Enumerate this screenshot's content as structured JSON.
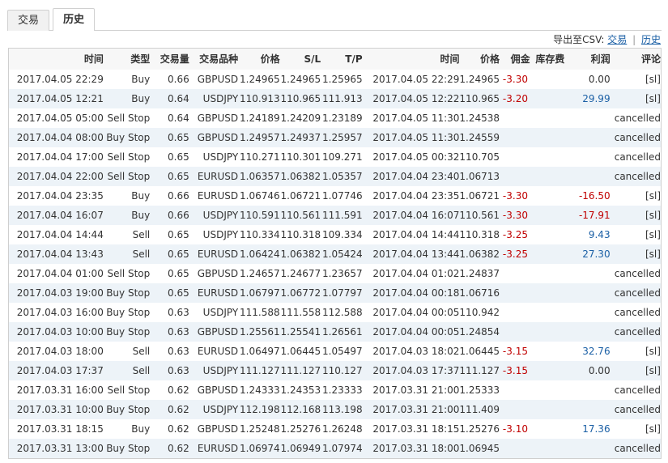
{
  "tabs": [
    {
      "label": "交易",
      "active": false
    },
    {
      "label": "历史",
      "active": true
    }
  ],
  "export": {
    "label": "导出至CSV:",
    "link1": "交易",
    "separator": "|",
    "link2": "历史"
  },
  "colors": {
    "negative": "#c00000",
    "positive": "#1a5fa5",
    "row_alt": "#edf3f8",
    "header_bg": "#f7f7f7"
  },
  "table": {
    "headers": [
      "时间",
      "类型",
      "交易量",
      "交易品种",
      "价格",
      "S/L",
      "T/P",
      "时间",
      "价格",
      "佣金",
      "库存费",
      "利润",
      "评论"
    ],
    "rows": [
      [
        "2017.04.05 22:29",
        "Buy",
        "0.66",
        "GBPUSD",
        "1.24965",
        "1.24965",
        "1.25965",
        "2017.04.05 22:29",
        "1.24965",
        "-3.30",
        "",
        "0.00",
        "[sl]"
      ],
      [
        "2017.04.05 12:21",
        "Buy",
        "0.64",
        "USDJPY",
        "110.913",
        "110.965",
        "111.913",
        "2017.04.05 12:22",
        "110.965",
        "-3.20",
        "",
        "29.99",
        "[sl]"
      ],
      [
        "2017.04.05 05:00",
        "Sell Stop",
        "0.64",
        "GBPUSD",
        "1.24189",
        "1.24209",
        "1.23189",
        "2017.04.05 11:30",
        "1.24538",
        "",
        "",
        "",
        "cancelled"
      ],
      [
        "2017.04.04 08:00",
        "Buy Stop",
        "0.65",
        "GBPUSD",
        "1.24957",
        "1.24937",
        "1.25957",
        "2017.04.05 11:30",
        "1.24559",
        "",
        "",
        "",
        "cancelled"
      ],
      [
        "2017.04.04 17:00",
        "Sell Stop",
        "0.65",
        "USDJPY",
        "110.271",
        "110.301",
        "109.271",
        "2017.04.05 00:32",
        "110.705",
        "",
        "",
        "",
        "cancelled"
      ],
      [
        "2017.04.04 22:00",
        "Sell Stop",
        "0.65",
        "EURUSD",
        "1.06357",
        "1.06382",
        "1.05357",
        "2017.04.04 23:40",
        "1.06713",
        "",
        "",
        "",
        "cancelled"
      ],
      [
        "2017.04.04 23:35",
        "Buy",
        "0.66",
        "EURUSD",
        "1.06746",
        "1.06721",
        "1.07746",
        "2017.04.04 23:35",
        "1.06721",
        "-3.30",
        "",
        "-16.50",
        "[sl]"
      ],
      [
        "2017.04.04 16:07",
        "Buy",
        "0.66",
        "USDJPY",
        "110.591",
        "110.561",
        "111.591",
        "2017.04.04 16:07",
        "110.561",
        "-3.30",
        "",
        "-17.91",
        "[sl]"
      ],
      [
        "2017.04.04 14:44",
        "Sell",
        "0.65",
        "USDJPY",
        "110.334",
        "110.318",
        "109.334",
        "2017.04.04 14:44",
        "110.318",
        "-3.25",
        "",
        "9.43",
        "[sl]"
      ],
      [
        "2017.04.04 13:43",
        "Sell",
        "0.65",
        "EURUSD",
        "1.06424",
        "1.06382",
        "1.05424",
        "2017.04.04 13:44",
        "1.06382",
        "-3.25",
        "",
        "27.30",
        "[sl]"
      ],
      [
        "2017.04.04 01:00",
        "Sell Stop",
        "0.65",
        "GBPUSD",
        "1.24657",
        "1.24677",
        "1.23657",
        "2017.04.04 01:02",
        "1.24837",
        "",
        "",
        "",
        "cancelled"
      ],
      [
        "2017.04.03 19:00",
        "Buy Stop",
        "0.65",
        "EURUSD",
        "1.06797",
        "1.06772",
        "1.07797",
        "2017.04.04 00:18",
        "1.06716",
        "",
        "",
        "",
        "cancelled"
      ],
      [
        "2017.04.03 16:00",
        "Buy Stop",
        "0.63",
        "USDJPY",
        "111.588",
        "111.558",
        "112.588",
        "2017.04.04 00:05",
        "110.942",
        "",
        "",
        "",
        "cancelled"
      ],
      [
        "2017.04.03 10:00",
        "Buy Stop",
        "0.63",
        "GBPUSD",
        "1.25561",
        "1.25541",
        "1.26561",
        "2017.04.04 00:05",
        "1.24854",
        "",
        "",
        "",
        "cancelled"
      ],
      [
        "2017.04.03 18:00",
        "Sell",
        "0.63",
        "EURUSD",
        "1.06497",
        "1.06445",
        "1.05497",
        "2017.04.03 18:02",
        "1.06445",
        "-3.15",
        "",
        "32.76",
        "[sl]"
      ],
      [
        "2017.04.03 17:37",
        "Sell",
        "0.63",
        "USDJPY",
        "111.127",
        "111.127",
        "110.127",
        "2017.04.03 17:37",
        "111.127",
        "-3.15",
        "",
        "0.00",
        "[sl]"
      ],
      [
        "2017.03.31 16:00",
        "Sell Stop",
        "0.62",
        "GBPUSD",
        "1.24333",
        "1.24353",
        "1.23333",
        "2017.03.31 21:00",
        "1.25333",
        "",
        "",
        "",
        "cancelled"
      ],
      [
        "2017.03.31 10:00",
        "Buy Stop",
        "0.62",
        "USDJPY",
        "112.198",
        "112.168",
        "113.198",
        "2017.03.31 21:00",
        "111.409",
        "",
        "",
        "",
        "cancelled"
      ],
      [
        "2017.03.31 18:15",
        "Buy",
        "0.62",
        "GBPUSD",
        "1.25248",
        "1.25276",
        "1.26248",
        "2017.03.31 18:15",
        "1.25276",
        "-3.10",
        "",
        "17.36",
        "[sl]"
      ],
      [
        "2017.03.31 13:00",
        "Buy Stop",
        "0.62",
        "EURUSD",
        "1.06974",
        "1.06949",
        "1.07974",
        "2017.03.31 18:00",
        "1.06945",
        "",
        "",
        "",
        "cancelled"
      ]
    ]
  }
}
